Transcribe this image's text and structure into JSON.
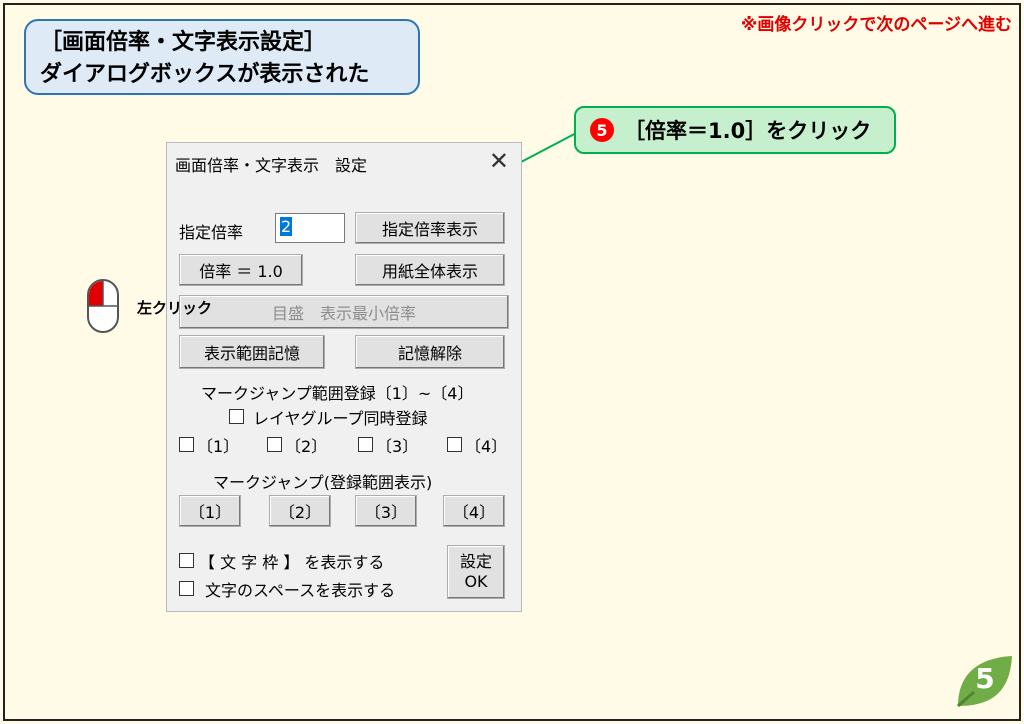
{
  "nav_hint": "※画像クリックで次のページへ進む",
  "title": {
    "line1": "［画面倍率・文字表示設定］",
    "line2": "ダイアログボックスが表示された"
  },
  "callout": {
    "number": "5",
    "text": "［倍率＝1.0］をクリック"
  },
  "mouse_label": "左クリック",
  "dialog": {
    "title": "画面倍率・文字表示　設定",
    "close": "✕",
    "zoom_label": "指定倍率",
    "zoom_value": "2",
    "btn_show_zoom": "指定倍率表示",
    "btn_ratio_one": "倍率 ＝ 1.0",
    "btn_whole_paper": "用紙全体表示",
    "btn_scale_min": "目盛　表示最小倍率",
    "btn_save_range": "表示範囲記憶",
    "btn_clear_memory": "記憶解除",
    "mark_register_label": "マークジャンプ範囲登録〔1〕~〔4〕",
    "layer_group_label": "レイヤグループ同時登録",
    "register_checks": [
      "〔1〕",
      "〔2〕",
      "〔3〕",
      "〔4〕"
    ],
    "jump_label": "マークジャンプ(登録範囲表示)",
    "jump_buttons": [
      "〔1〕",
      "〔2〕",
      "〔3〕",
      "〔4〕"
    ],
    "show_char_frame": "【 文 字 枠 】 を表示する",
    "show_char_space": "文字のスペースを表示する",
    "ok_line1": "設定",
    "ok_line2": "OK"
  },
  "page_number": "5",
  "colors": {
    "accent_red": "#e00000",
    "callout_green": "#00b050",
    "title_blue": "#2e75b6",
    "leaf_green": "#70ad47"
  }
}
